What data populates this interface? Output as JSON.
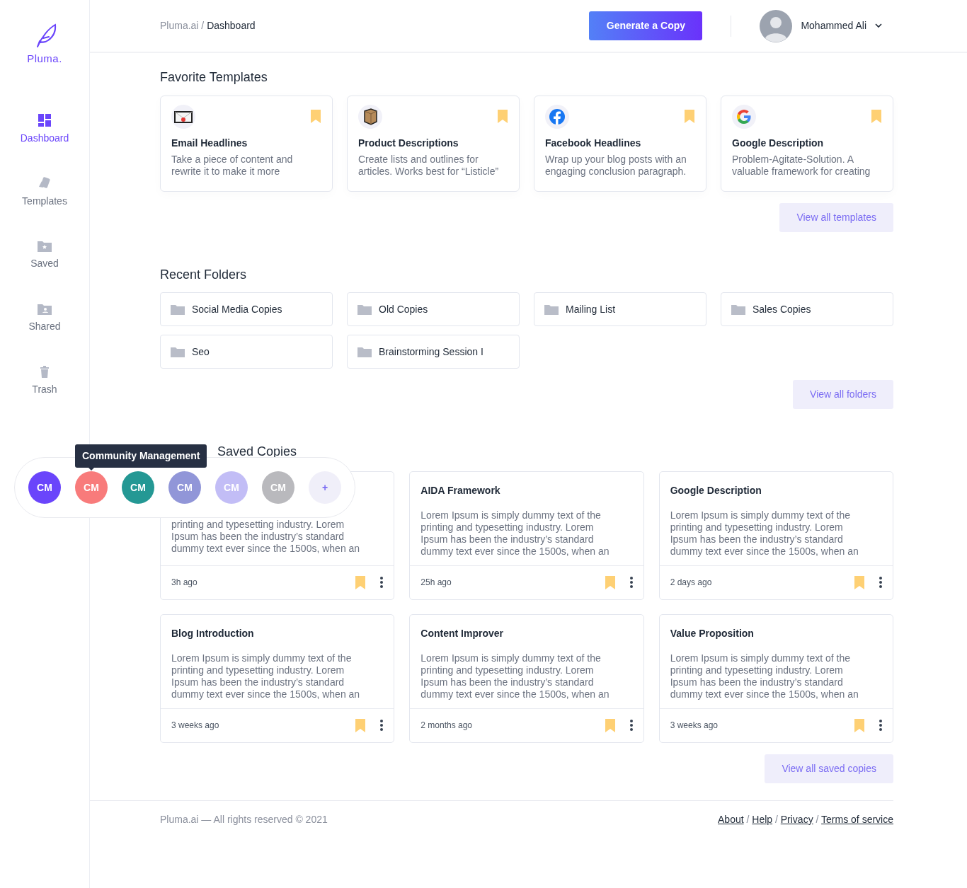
{
  "brand": "Pluma.",
  "sidebar": {
    "items": [
      {
        "label": "Dashboard",
        "selected": true
      },
      {
        "label": "Templates",
        "selected": false
      },
      {
        "label": "Saved",
        "selected": false
      },
      {
        "label": "Shared",
        "selected": false
      },
      {
        "label": "Trash",
        "selected": false
      }
    ]
  },
  "header": {
    "breadcrumb": [
      "Pluma.ai",
      "Dashboard"
    ],
    "breadcrumb_separator": "/",
    "button": "Generate a Copy",
    "user": "Mohammed Ali"
  },
  "favorite_templates": {
    "title": "Favorite Templates",
    "items": [
      {
        "title": "Email Headlines",
        "text": "Take a piece of content and rewrite it to make it more",
        "bookmarked": true
      },
      {
        "title": "Product Descriptions",
        "text": "Create lists and outlines for articles. Works best for “Listicle”",
        "bookmarked": true
      },
      {
        "title": "Facebook Headlines",
        "text": "Wrap up your blog posts with an engaging conclusion paragraph.",
        "bookmarked": true
      },
      {
        "title": "Google Description",
        "text": "Problem-Agitate-Solution. A valuable framework for creating",
        "bookmarked": true
      }
    ],
    "link": "View all templates"
  },
  "recent_folders": {
    "title": "Recent Folders",
    "items": [
      "Social Media Copies",
      "Old Copies",
      "Mailing List",
      "Sales Copies",
      "Seo",
      "Brainstorming Session I"
    ],
    "link": "View all folders"
  },
  "saved_copies": {
    "title": "Saved Copies",
    "items": [
      {
        "text": "printing and typesetting industry. Lorem Ipsum has been the industry’s standard dummy text ever since the 1500s, when an",
        "time": "3h ago",
        "bookmarked": true
      },
      {
        "title": "AIDA Framework",
        "text": "Lorem Ipsum is simply dummy text of the printing and typesetting industry. Lorem Ipsum has been the industry’s standard dummy text ever since the 1500s, when an",
        "time": "25h ago",
        "bookmarked": true
      },
      {
        "title": "Google Description",
        "text": "Lorem Ipsum is simply dummy text of the printing and typesetting industry. Lorem Ipsum has been the industry’s standard dummy text ever since the 1500s, when an",
        "time": "2 days ago",
        "bookmarked": true
      },
      {
        "title": "Blog Introduction",
        "text": "Lorem Ipsum is simply dummy text of the printing and typesetting industry. Lorem Ipsum has been the industry’s standard dummy text ever since the 1500s, when an",
        "time": "3 weeks ago",
        "bookmarked": true
      },
      {
        "title": "Content Improver",
        "text": "Lorem Ipsum is simply dummy text of the printing and typesetting industry. Lorem Ipsum has been the industry’s standard dummy text ever since the 1500s, when an",
        "time": "2 months ago",
        "bookmarked": true
      },
      {
        "title": "Value Proposition",
        "text": "Lorem Ipsum is simply dummy text of the printing and typesetting industry. Lorem Ipsum has been the industry’s standard dummy text ever since the 1500s, when an",
        "time": "3 weeks ago",
        "bookmarked": true
      }
    ],
    "link": "View all saved copies"
  },
  "workspace_popup": {
    "chips": [
      {
        "label": "CM",
        "color": "#6a45fb"
      },
      {
        "label": "CM",
        "color": "#f87b7b",
        "tooltip": "Community Management"
      },
      {
        "label": "CM",
        "color": "#249894"
      },
      {
        "label": "CM",
        "color": "#9196d8"
      },
      {
        "label": "CM",
        "color": "#c2bdf6"
      },
      {
        "label": "CM",
        "color": "#b9b9bd"
      },
      {
        "label": "+",
        "color": "#f0eff9",
        "kind": "add"
      }
    ]
  },
  "footer": {
    "copyright": "Pluma.ai — All rights reserved © 2021",
    "links": [
      "About",
      "Help",
      "Privacy",
      "Terms of service"
    ],
    "separator": "/"
  }
}
